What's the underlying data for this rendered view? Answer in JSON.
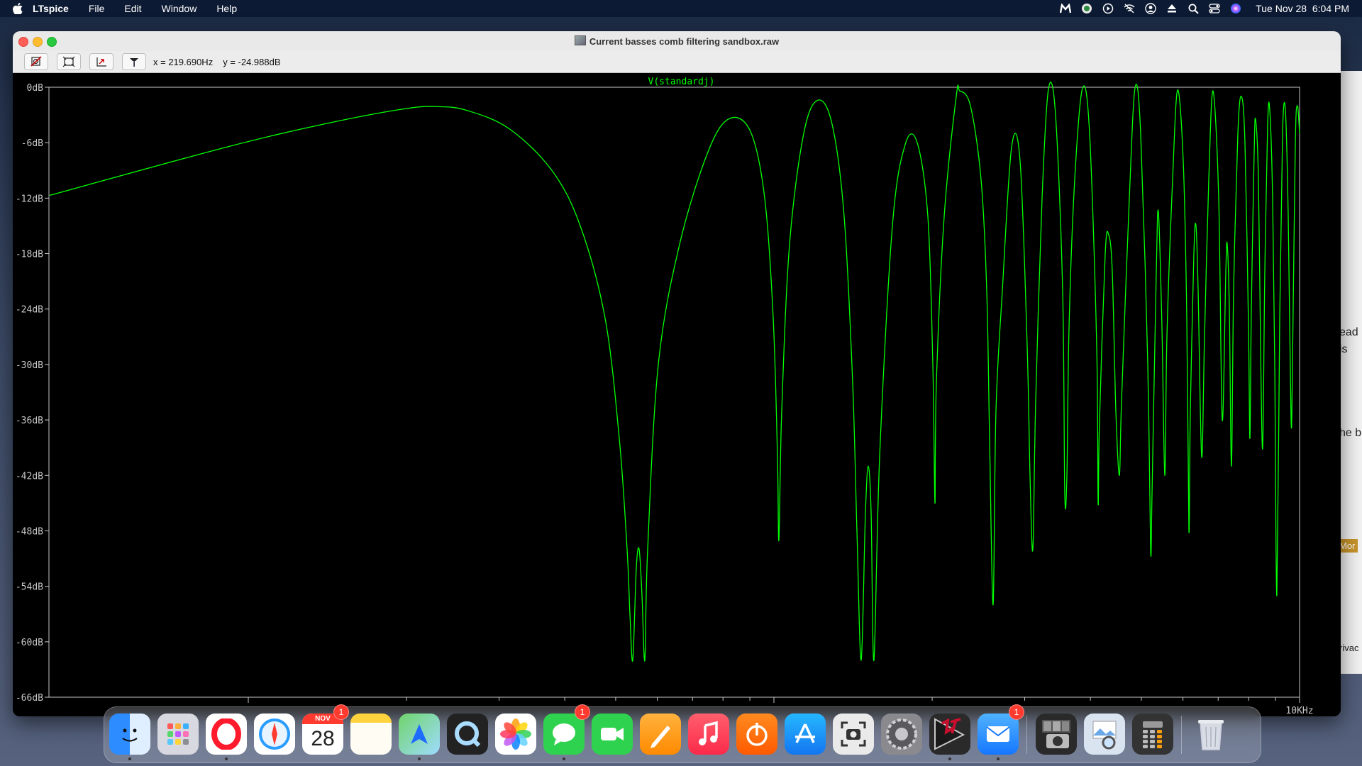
{
  "menubar": {
    "app_name": "LTspice",
    "menus": [
      "File",
      "Edit",
      "Window",
      "Help"
    ],
    "clock": "Tue Nov 28  6:04 PM"
  },
  "window": {
    "title": "Current basses comb filtering sandbox.raw",
    "cursor_x": "x = 219.690Hz",
    "cursor_y": "y = -24.988dB"
  },
  "background_window": {
    "fragments": [
      "ead",
      "is",
      "he b",
      "Mor",
      "rivac"
    ]
  },
  "plot": {
    "trace_label": "V(standardj)",
    "x_end_label": "10KHz",
    "trace_color": "#00ff00",
    "axis_color": "#c8c8c8"
  },
  "chart_data": {
    "type": "line",
    "title": "",
    "xlabel": "",
    "ylabel": "",
    "x_scale": "log",
    "ylim": [
      -66,
      0
    ],
    "y_ticks": [
      "0dB",
      "-6dB",
      "-12dB",
      "-18dB",
      "-24dB",
      "-30dB",
      "-36dB",
      "-42dB",
      "-48dB",
      "-54dB",
      "-60dB",
      "-66dB"
    ],
    "x_end_label": "10KHz",
    "series": [
      {
        "name": "V(standardj)",
        "approx_shape": "comb filter magnitude: rises to about -2dB near the low end, then deep notches reaching about -62dB, then repeated lobes up to about 0dB with notches between -40dB and -58dB toward 10KHz",
        "peaks_db": [
          -2.1,
          -3.1,
          -1.2,
          -4.4,
          -0.3,
          -6.1,
          -0.1,
          -8.5,
          0,
          -13,
          -0.1,
          -12,
          -0.2,
          -14,
          -0.3,
          -0.4,
          -1.5,
          -0.6,
          -0.7,
          -1.6
        ],
        "notches_db": [
          -62,
          -49,
          -62,
          -49,
          -62.5,
          -41,
          -38,
          -62,
          -48,
          -42,
          -50,
          -42,
          -55,
          -45,
          -56,
          -50,
          -46,
          -50,
          -56,
          -48,
          -53,
          -42,
          -57.5,
          -38
        ]
      }
    ]
  },
  "dock": {
    "calendar_month": "NOV",
    "calendar_day": "28",
    "badges": {
      "calendar": "1",
      "messages": "1",
      "mail": "1"
    },
    "apps": [
      "finder-icon",
      "launchpad-icon",
      "opera-icon",
      "safari-icon",
      "calendar-icon",
      "notes-icon",
      "maps-icon",
      "quicktime-icon",
      "photos-icon",
      "messages-icon",
      "facetime-icon",
      "pages-icon",
      "music-icon",
      "castro-icon",
      "app-store-icon",
      "screenshot-icon",
      "system-preferences-icon",
      "ltspice-icon",
      "mail-icon",
      "photo-booth-icon",
      "preview-icon",
      "calculator-icon",
      "trash-icon"
    ]
  }
}
